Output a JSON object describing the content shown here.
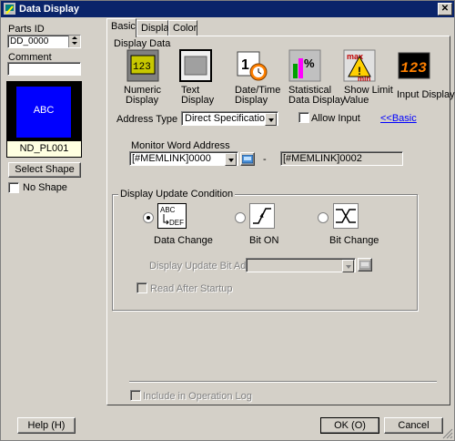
{
  "window": {
    "title": "Data Display"
  },
  "left": {
    "parts_id_label": "Parts ID",
    "parts_id_value": "DD_0000",
    "comment_label": "Comment",
    "comment_value": "",
    "preview_text": "ABC",
    "shape_name": "ND_PL001",
    "select_shape_label": "Select Shape",
    "no_shape_label": "No Shape"
  },
  "tabs": [
    {
      "label": "Basic"
    },
    {
      "label": "Display"
    },
    {
      "label": "Color"
    }
  ],
  "display_data": {
    "label": "Display Data",
    "types": [
      {
        "label_1": "Numeric",
        "label_2": "Display",
        "icon": "numeric-display-icon"
      },
      {
        "label_1": "Text",
        "label_2": "Display",
        "icon": "text-display-icon"
      },
      {
        "label_1": "Date/Time",
        "label_2": "Display",
        "icon": "datetime-display-icon"
      },
      {
        "label_1": "Statistical",
        "label_2": "Data Display",
        "icon": "statistical-display-icon"
      },
      {
        "label_1": "Show Limit",
        "label_2": "Value",
        "icon": "show-limit-icon"
      },
      {
        "label_1": "Input Display",
        "label_2": "",
        "icon": "input-display-icon"
      }
    ]
  },
  "address_type": {
    "label": "Address Type",
    "value": "Direct Specification",
    "allow_input_label": "Allow Input",
    "basic_link": "<<Basic"
  },
  "monitor": {
    "label": "Monitor Word Address",
    "start_value": "[#MEMLINK]0000",
    "dash": "-",
    "end_value": "[#MEMLINK]0002"
  },
  "update": {
    "group_label": "Display Update Condition",
    "options": [
      {
        "label": "Data Change",
        "selected": true,
        "icon": "data-change-icon"
      },
      {
        "label": "Bit ON",
        "selected": false,
        "icon": "bit-on-icon"
      },
      {
        "label": "Bit Change",
        "selected": false,
        "icon": "bit-change-icon"
      }
    ],
    "bit_address_label": "Display Update Bit Address",
    "bit_address_value": "",
    "read_after_startup_label": "Read After Startup"
  },
  "include_log_label": "Include in Operation Log",
  "footer": {
    "help_label": "Help (H)",
    "ok_label": "OK (O)",
    "cancel_label": "Cancel"
  },
  "colors": {
    "titlebar": "#0a246a",
    "preview_bg": "#0000ff",
    "shape_name_bg": "#ffffe1",
    "link": "#0000ff"
  }
}
